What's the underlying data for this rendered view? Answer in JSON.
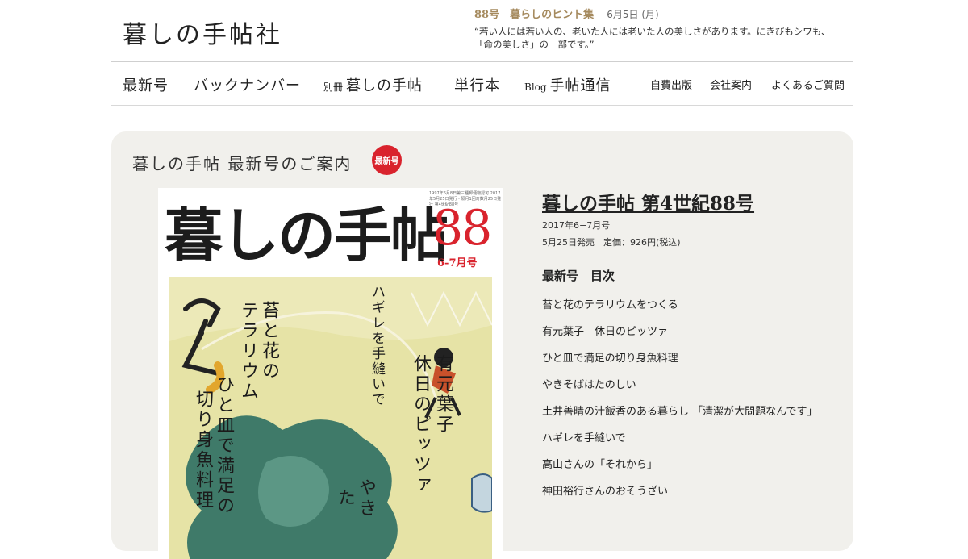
{
  "site": {
    "logo": "暮しの手帖社"
  },
  "hint": {
    "link": "88号　暮らしのヒント集",
    "date": "6月5日 (月)",
    "quote": "“若い人には若い人の、老いた人には老いた人の美しさがあります。にきびもシワも、「命の美しさ」の一部です。”"
  },
  "nav": {
    "latest": "最新号",
    "backnumber": "バックナンバー",
    "bessatsu_prefix": "別冊",
    "bessatsu": "暮しの手帖",
    "books": "単行本",
    "blog_prefix": "Blog",
    "blog": "手帖通信",
    "self_pub": "自費出版",
    "company": "会社案内",
    "faq": "よくあるご質問"
  },
  "panel": {
    "title": "暮しの手帖 最新号のご案内",
    "badge": "最新号"
  },
  "cover": {
    "title": "暮しの手帖",
    "number": "88",
    "issue": "6-7月号",
    "smallprint": "1997年6月8日第三種郵便物認可 2017年5月25日発行・隔月1回奇数月25日発行 第4世紀88号",
    "headlines": {
      "h1": "苔と花の",
      "h2": "テラリウム",
      "h3": "ハギレを手縫いで",
      "h4": "有元葉子",
      "h5": "休日のピッツァ",
      "h6": "ひと皿で満足の",
      "h7": "切り身魚料理",
      "h8": "やき",
      "h9": "た"
    }
  },
  "issue": {
    "title": "暮しの手帖 第4世紀88号",
    "period": "2017年6−7月号",
    "release": "5月25日発売　定価：926円(税込)",
    "toc_heading": "最新号　目次",
    "toc": [
      "苔と花のテラリウムをつくる",
      "有元葉子　休日のピッツァ",
      "ひと皿で満足の切り身魚料理",
      "やきそばはたのしい",
      "土井善晴の汁飯香のある暮らし 「清潔が大問題なんです」",
      "ハギレを手縫いで",
      "高山さんの「それから」",
      "神田裕行さんのおそうざい"
    ]
  },
  "colors": {
    "accent_red": "#d9232d",
    "hint_gold": "#a58a5e",
    "panel_bg": "#f1f0ec"
  }
}
